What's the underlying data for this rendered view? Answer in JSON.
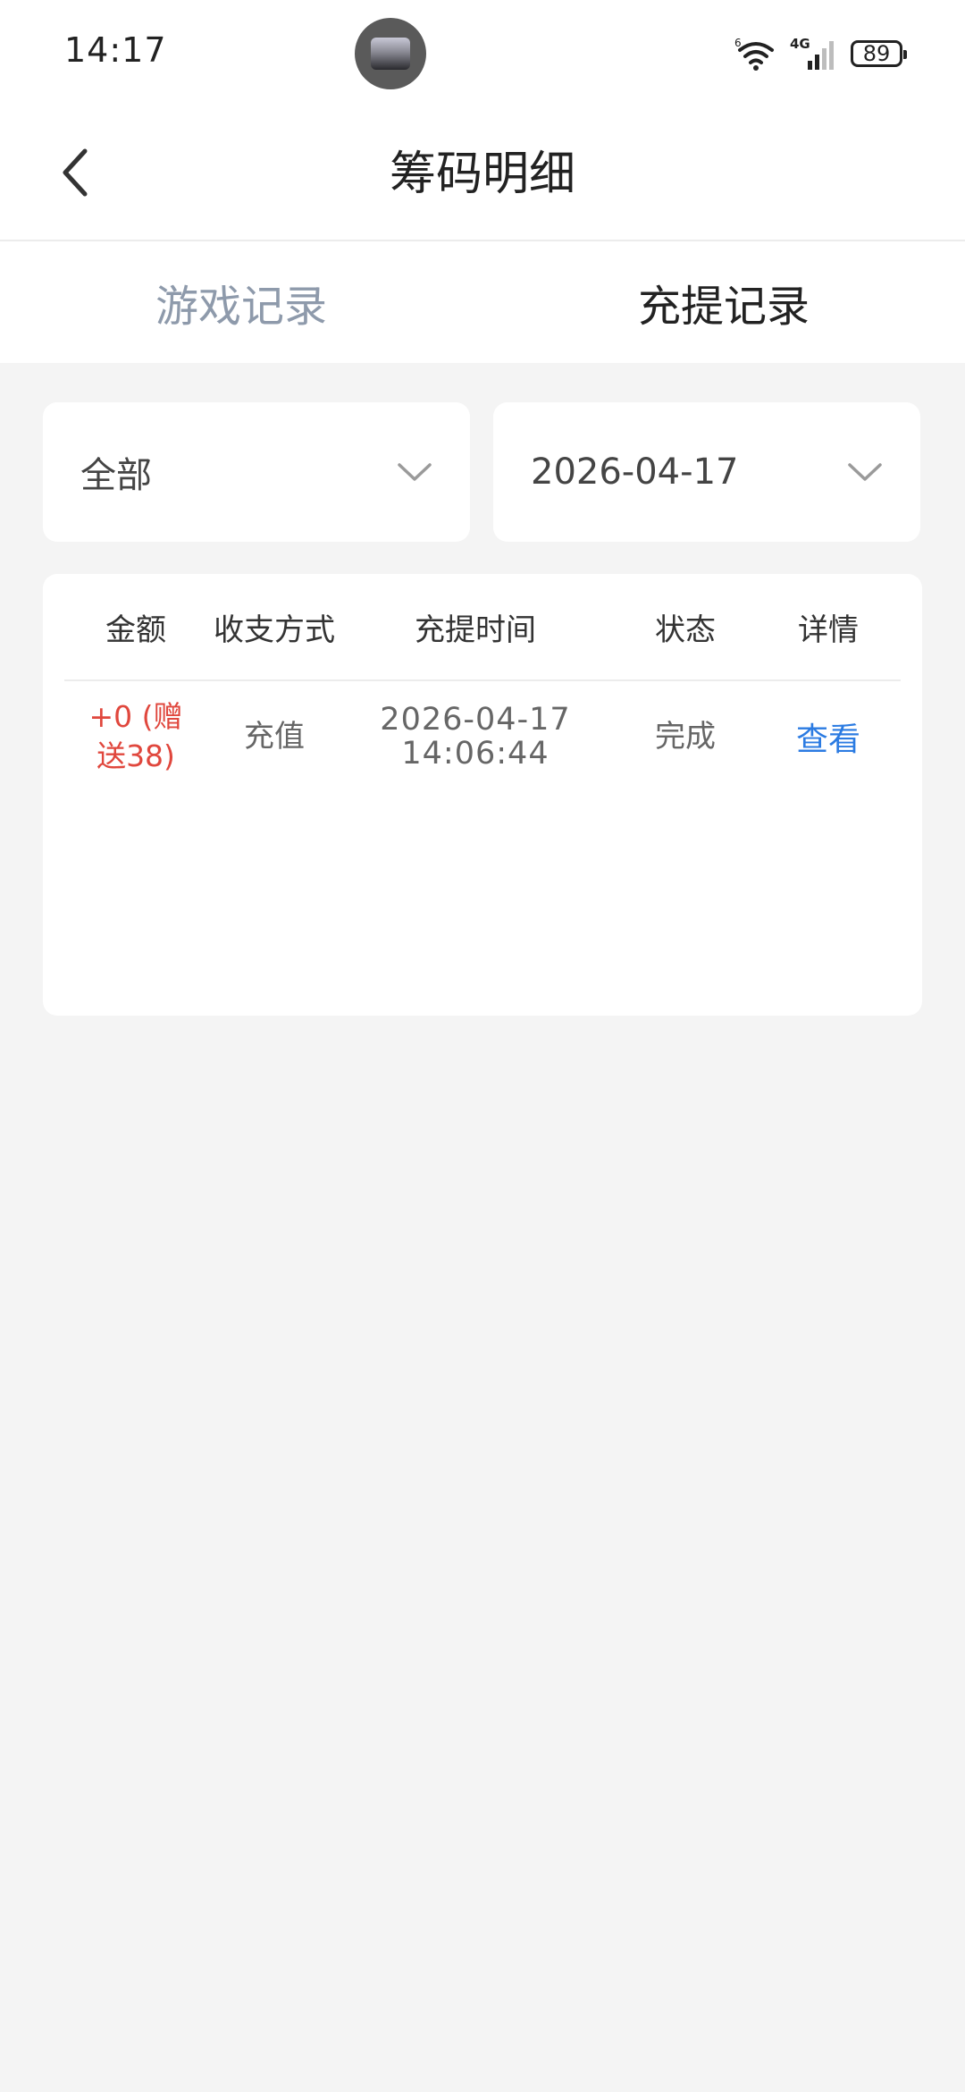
{
  "status_bar": {
    "time": "14:17",
    "network": "4G",
    "wifi_badge": "6",
    "battery": "89"
  },
  "header": {
    "title": "筹码明细"
  },
  "tabs": [
    {
      "label": "游戏记录",
      "active": false
    },
    {
      "label": "充提记录",
      "active": true
    }
  ],
  "filters": {
    "type": {
      "value": "全部"
    },
    "date": {
      "value": "2026-04-17"
    }
  },
  "table": {
    "columns": [
      "金额",
      "收支方式",
      "充提时间",
      "状态",
      "详情"
    ],
    "rows": [
      {
        "amount": "+0 (赠送38)",
        "method": "充值",
        "date": "2026-04-17",
        "time": "14:06:44",
        "status": "完成",
        "detail": "查看"
      }
    ]
  },
  "colors": {
    "amount": "#e0473d",
    "link": "#2b7be2",
    "inactive_tab": "#8e9aab",
    "page_background": "#f4f4f4"
  },
  "icons": [
    "back-arrow-icon",
    "chevron-down-icon",
    "wifi-icon",
    "signal-icon",
    "battery-icon"
  ]
}
